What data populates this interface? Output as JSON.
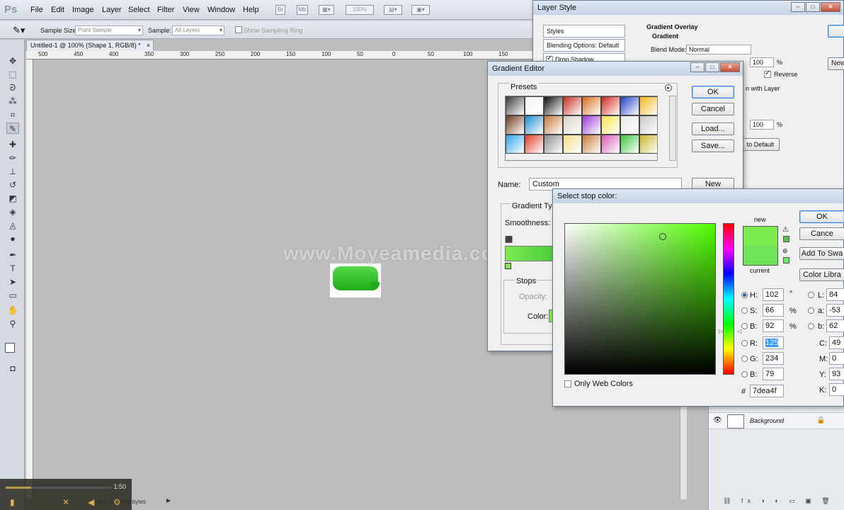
{
  "app": {
    "logo": "Ps"
  },
  "menu": [
    "File",
    "Edit",
    "Image",
    "Layer",
    "Select",
    "Filter",
    "View",
    "Window",
    "Help"
  ],
  "menubar_extra": {
    "zoom": "100%"
  },
  "options": {
    "sample_size_label": "Sample Size:",
    "sample_size_value": "Point Sample",
    "sample_label": "Sample:",
    "sample_value": "All Layers",
    "show_ring": "Show Sampling Ring"
  },
  "document": {
    "tab_title": "Untitled-1 @ 100% (Shape 1, RGB/8) *",
    "ruler_ticks": [
      "500",
      "450",
      "400",
      "350",
      "300",
      "250",
      "200",
      "150",
      "100",
      "50",
      "0",
      "50",
      "100",
      "150",
      "200"
    ],
    "watermark": "www.Moyeamedia.com",
    "status": "Doc: 1.6M/35 bytes"
  },
  "video": {
    "time": "1:50",
    "progress": 0.24
  },
  "layers": {
    "background_name": "Background"
  },
  "layer_style": {
    "title": "Layer Style",
    "list": [
      "Styles",
      "Blending Options: Default",
      "Drop Shadow"
    ],
    "section": "Gradient Overlay",
    "subsection": "Gradient",
    "blend_mode_label": "Blend Mode:",
    "blend_mode_value": "Normal",
    "opacity_value": "100",
    "opacity_unit": "%",
    "reverse_label": "Reverse",
    "align_label": "n with Layer",
    "scale_value": "100",
    "scale_unit": "%",
    "reset_label": "to Default",
    "ok_partial": "",
    "new_partial": "New"
  },
  "gradient_editor": {
    "title": "Gradient Editor",
    "presets_label": "Presets",
    "ok": "OK",
    "cancel": "Cancel",
    "load": "Load...",
    "save": "Save...",
    "name_label": "Name:",
    "name_value": "Custom",
    "new": "New",
    "gradient_type_label": "Gradient Typ",
    "smoothness_label": "Smoothness:",
    "stops_label": "Stops",
    "opacity_label": "Opacity:",
    "color_label": "Color:",
    "swatches": [
      "#3b3b3b",
      "#f4f4f4",
      "#111111",
      "#c43021",
      "#d86d1e",
      "#d2281f",
      "#2340c8",
      "#f2b51c",
      "#6e3b1f",
      "#1f8cd2",
      "#c87a3c",
      "#d8d0c2",
      "#9b3ad8",
      "#f2e84a",
      "#e8e8e8",
      "#c8c8c8",
      "#2fa4e6",
      "#e13e2b",
      "#8c8c8c",
      "#f0dc88",
      "#c87a3c",
      "#d85ab4",
      "#3cc83c",
      "#c8b42a"
    ]
  },
  "color_picker": {
    "title": "Select stop color:",
    "ok": "OK",
    "cancel": "Cance",
    "add_swatches": "Add To Swa",
    "color_libraries": "Color Libra",
    "new_label": "new",
    "current_label": "current",
    "only_web": "Only Web Colors",
    "h_label": "H:",
    "h_value": "102",
    "h_unit": "°",
    "s_label": "S:",
    "s_value": "66",
    "s_unit": "%",
    "b_label": "B:",
    "b_value": "92",
    "b_unit": "%",
    "r_label": "R:",
    "r_value": "125",
    "g_label": "G:",
    "g_value": "234",
    "bl_label": "B:",
    "bl_value": "79",
    "hex_label": "#",
    "hex_value": "7dea4f",
    "l_label": "L:",
    "l_value": "84",
    "a_label": "a:",
    "a_value": "-53",
    "lab_b_label": "b:",
    "lab_b_value": "62",
    "c_label": "C:",
    "c_value": "49",
    "m_label": "M:",
    "m_value": "0",
    "y_label": "Y:",
    "y_value": "93",
    "k_label": "K:",
    "k_value": "0",
    "new_color": "#7dea4f",
    "current_color": "#6de45a"
  }
}
